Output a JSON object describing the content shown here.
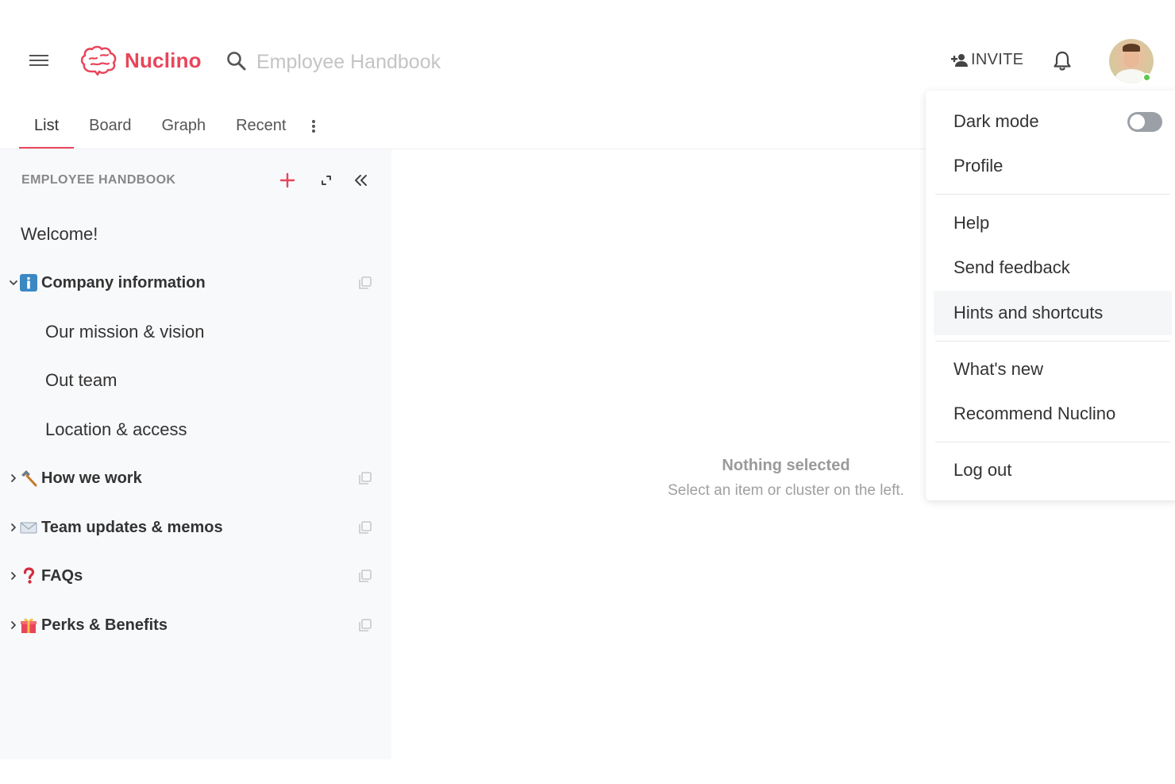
{
  "header": {
    "brand": "Nuclino",
    "search_placeholder": "Employee Handbook",
    "invite_label": "INVITE",
    "accent_color": "#e8455a"
  },
  "tabs": [
    {
      "label": "List",
      "active": true
    },
    {
      "label": "Board",
      "active": false
    },
    {
      "label": "Graph",
      "active": false
    },
    {
      "label": "Recent",
      "active": false
    }
  ],
  "sidebar": {
    "title": "EMPLOYEE HANDBOOK",
    "items": [
      {
        "label": "Welcome!",
        "type": "page"
      },
      {
        "label": "Company information",
        "type": "cluster",
        "expanded": true,
        "icon": "info-icon"
      },
      {
        "label": "Our mission & vision",
        "type": "child"
      },
      {
        "label": "Out team",
        "type": "child"
      },
      {
        "label": "Location & access",
        "type": "child"
      },
      {
        "label": "How we work",
        "type": "cluster",
        "expanded": false,
        "icon": "hammer-icon"
      },
      {
        "label": "Team updates & memos",
        "type": "cluster",
        "expanded": false,
        "icon": "envelope-icon"
      },
      {
        "label": "FAQs",
        "type": "cluster",
        "expanded": false,
        "icon": "question-icon"
      },
      {
        "label": "Perks & Benefits",
        "type": "cluster",
        "expanded": false,
        "icon": "gift-icon"
      }
    ]
  },
  "main": {
    "empty_title": "Nothing selected",
    "empty_subtitle": "Select an item or cluster on the left."
  },
  "menu": {
    "dark_mode": "Dark mode",
    "dark_mode_on": false,
    "profile": "Profile",
    "help": "Help",
    "send_feedback": "Send feedback",
    "hints": "Hints and shortcuts",
    "whats_new": "What's new",
    "recommend": "Recommend Nuclino",
    "logout": "Log out"
  }
}
